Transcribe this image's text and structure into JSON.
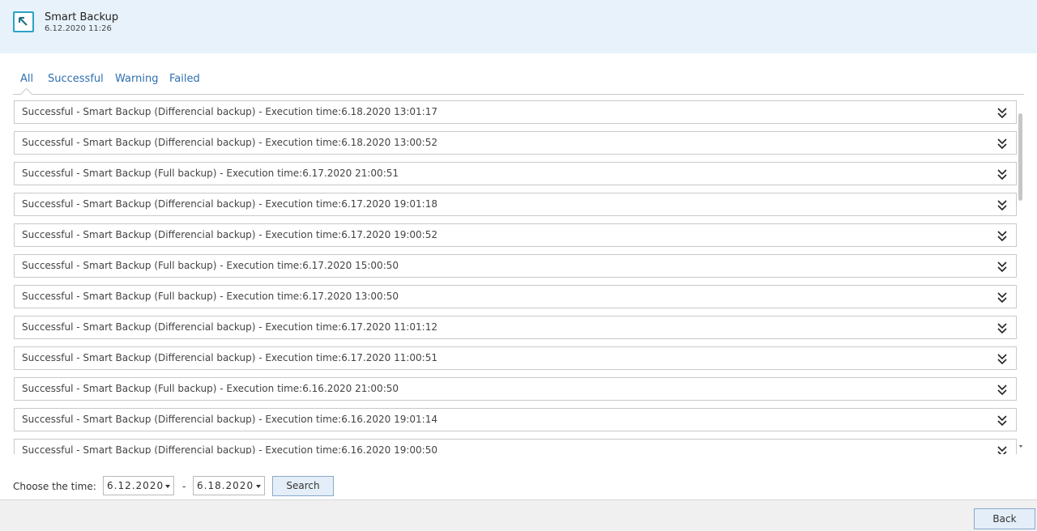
{
  "header": {
    "icon": "arrow-cursor-icon",
    "title": "Smart Backup",
    "subtitle": "6.12.2020 11:26"
  },
  "tabs": [
    {
      "label": "All",
      "active": true
    },
    {
      "label": "Successful",
      "active": false
    },
    {
      "label": "Warning",
      "active": false
    },
    {
      "label": "Failed",
      "active": false
    }
  ],
  "logs": [
    {
      "text": "Successful - Smart Backup (Differencial backup) - Execution time:6.18.2020 13:01:17"
    },
    {
      "text": "Successful - Smart Backup (Differencial backup) - Execution time:6.18.2020 13:00:52"
    },
    {
      "text": "Successful - Smart Backup (Full backup) - Execution time:6.17.2020 21:00:51"
    },
    {
      "text": "Successful - Smart Backup (Differencial backup) - Execution time:6.17.2020 19:01:18"
    },
    {
      "text": "Successful - Smart Backup (Differencial backup) - Execution time:6.17.2020 19:00:52"
    },
    {
      "text": "Successful - Smart Backup (Full backup) - Execution time:6.17.2020 15:00:50"
    },
    {
      "text": "Successful - Smart Backup (Full backup) - Execution time:6.17.2020 13:00:50"
    },
    {
      "text": "Successful - Smart Backup (Differencial backup) - Execution time:6.17.2020 11:01:12"
    },
    {
      "text": "Successful - Smart Backup (Differencial backup) - Execution time:6.17.2020 11:00:51"
    },
    {
      "text": "Successful - Smart Backup (Full backup) - Execution time:6.16.2020 21:00:50"
    },
    {
      "text": "Successful - Smart Backup (Differencial backup) - Execution time:6.16.2020 19:01:14"
    },
    {
      "text": "Successful - Smart Backup (Differencial backup) - Execution time:6.16.2020 19:00:50"
    }
  ],
  "filter": {
    "label": "Choose the time:",
    "from": "6.12.2020",
    "separator": "-",
    "to": "6.18.2020",
    "search_label": "Search"
  },
  "footer": {
    "back_label": "Back"
  },
  "colors": {
    "header_bg": "#e8f2fb",
    "tab_text": "#2f6fb0",
    "icon_accent": "#2aa3c5"
  }
}
